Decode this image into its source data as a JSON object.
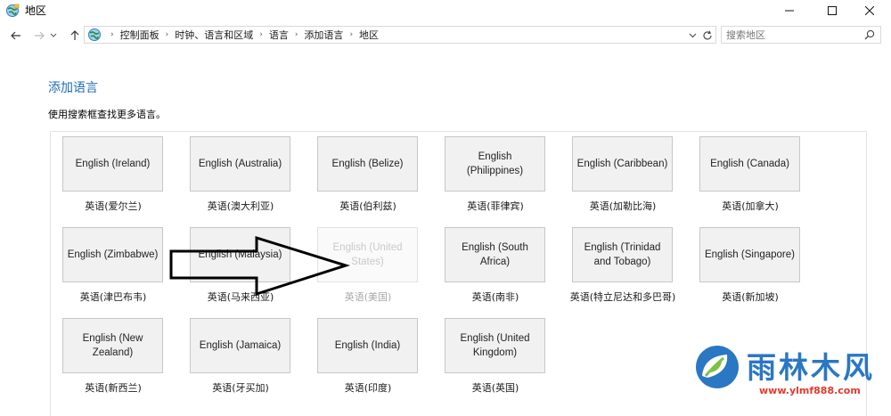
{
  "window": {
    "title": "地区",
    "minimize_label": "minimize",
    "maximize_label": "maximize",
    "close_label": "close"
  },
  "nav": {
    "icons": [
      "back-arrow-icon",
      "forward-arrow-icon",
      "recent-chevron-icon",
      "up-arrow-icon",
      "refresh-icon"
    ]
  },
  "breadcrumb": {
    "items": [
      "控制面板",
      "时钟、语言和区域",
      "语言",
      "添加语言",
      "地区"
    ]
  },
  "search": {
    "placeholder": "搜索地区"
  },
  "main": {
    "title": "添加语言",
    "description": "使用搜索框查找更多语言。"
  },
  "languages": [
    {
      "name": "English (Ireland)",
      "caption": "英语(爱尔兰)",
      "enabled": true
    },
    {
      "name": "English (Australia)",
      "caption": "英语(澳大利亚)",
      "enabled": true
    },
    {
      "name": "English (Belize)",
      "caption": "英语(伯利兹)",
      "enabled": true
    },
    {
      "name": "English (Philippines)",
      "caption": "英语(菲律宾)",
      "enabled": true
    },
    {
      "name": "English (Caribbean)",
      "caption": "英语(加勒比海)",
      "enabled": true
    },
    {
      "name": "English (Canada)",
      "caption": "英语(加拿大)",
      "enabled": true
    },
    {
      "name": "English (Zimbabwe)",
      "caption": "英语(津巴布韦)",
      "enabled": true
    },
    {
      "name": "English (Malaysia)",
      "caption": "英语(马来西亚)",
      "enabled": true
    },
    {
      "name": "English (United States)",
      "caption": "英语(美国)",
      "enabled": false
    },
    {
      "name": "English (South Africa)",
      "caption": "英语(南非)",
      "enabled": true
    },
    {
      "name": "English (Trinidad and Tobago)",
      "caption": "英语(特立尼达和多巴哥)",
      "enabled": true
    },
    {
      "name": "English (Singapore)",
      "caption": "英语(新加坡)",
      "enabled": true
    },
    {
      "name": "English (New Zealand)",
      "caption": "英语(新西兰)",
      "enabled": true
    },
    {
      "name": "English (Jamaica)",
      "caption": "英语(牙买加)",
      "enabled": true
    },
    {
      "name": "English (India)",
      "caption": "英语(印度)",
      "enabled": true
    },
    {
      "name": "English (United Kingdom)",
      "caption": "英语(英国)",
      "enabled": true
    }
  ],
  "watermark": {
    "text": "雨林木风",
    "url": "www.ylmf888.com"
  },
  "colors": {
    "link_blue": "#1e6bb8",
    "tile_bg": "#f1f1f1",
    "tile_border": "#c7c7c7",
    "watermark_blue": "#2a77c4",
    "watermark_red": "#e23a2e"
  }
}
